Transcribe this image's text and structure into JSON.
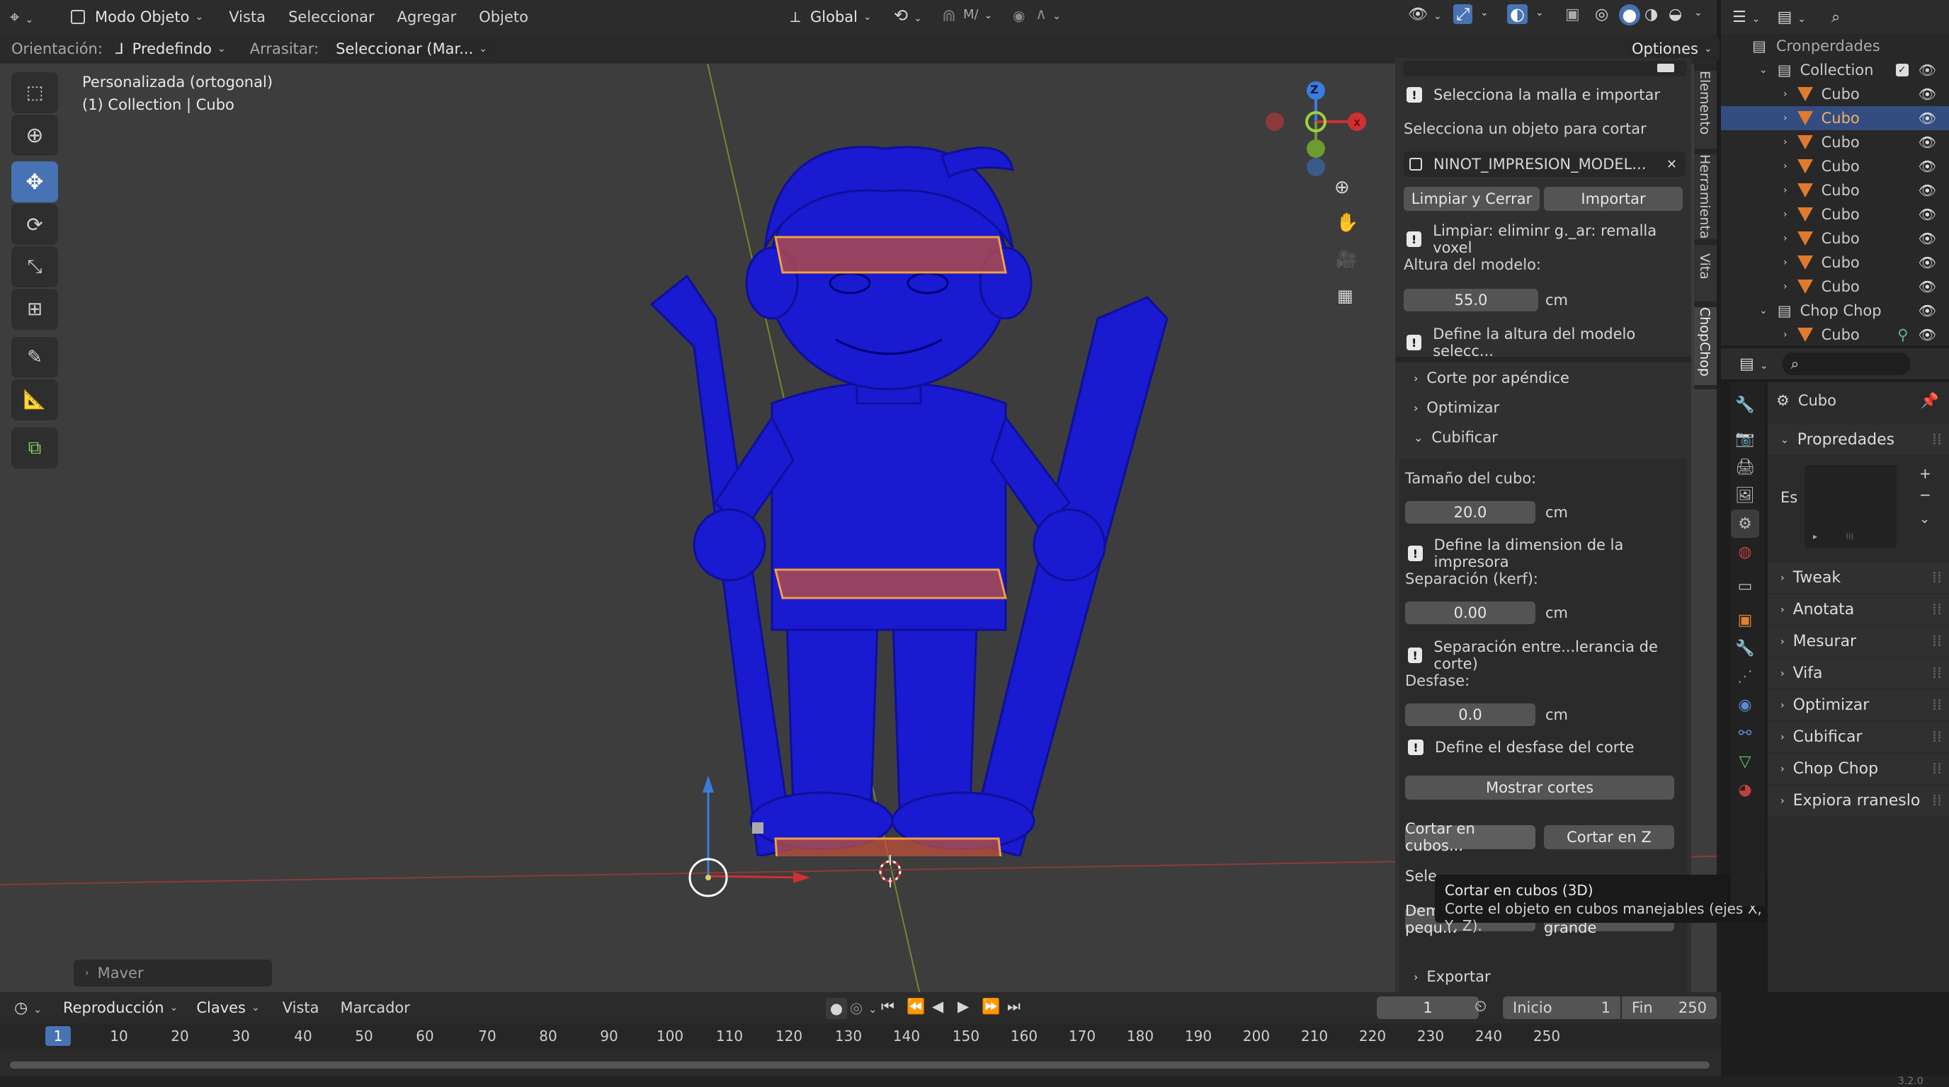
{
  "header": {
    "mode": "Modo Objeto",
    "menus": [
      "Vista",
      "Seleccionar",
      "Agregar",
      "Objeto"
    ],
    "transform_orientation": "Global"
  },
  "subheader": {
    "orientation_label": "Orientación:",
    "orientation_value": "Predefindo",
    "drag_label": "Arrasitar:",
    "drag_value": "Seleccionar (Mar...",
    "options": "Optiones"
  },
  "viewport": {
    "view_name": "Personalizada (ortogonal)",
    "collection_info": "(1) Collection | Cubo",
    "gizmo_z": "Z",
    "last_op": "Maver"
  },
  "npanel": {
    "tabs": [
      "Elemento",
      "Herramienta",
      "Vita",
      "ChopChop"
    ],
    "msg_select": "Selecciona la malla e importar",
    "select_cut_label": "Selecciona un objeto para cortar",
    "object_field": "NINOT_IMPRESION_MODEL...",
    "btn_clear_close": "Limpiar y Cerrar",
    "btn_import": "Importar",
    "msg_clear": "Limpiar: eliminr g._ar: remalla voxel",
    "height_label": "Altura del modelo:",
    "height_value": "55.0",
    "unit_cm": "cm",
    "msg_height": "Define la altura del modelo selecc...",
    "sections": [
      "Corte por apéndice",
      "Optimizar",
      "Cubificar"
    ],
    "cube_size_label": "Tamaño del cubo:",
    "cube_size_value": "20.0",
    "msg_cube": "Define la dimension de la impresora",
    "kerf_label": "Separación (kerf):",
    "kerf_value": "0.00",
    "msg_kerf": "Separación entre...lerancia de corte)",
    "offset_label": "Desfase:",
    "offset_value": "0.0",
    "msg_offset": "Define el desfase del corte",
    "btn_show_cuts": "Mostrar cortes",
    "btn_cut_cubes": "Cortar en cubos...",
    "btn_cut_z": "Cortar en Z",
    "sele_label": "Sele",
    "btn_too_small": "Demasiado pequ...",
    "btn_too_big": "Demasiado grande",
    "export": "Exportar"
  },
  "tooltip": {
    "title": "Cortar en cubos (3D)",
    "desc": "Corte el objeto en cubos manejables (ejes X, Y, Z)."
  },
  "outliner": {
    "root": "Cronperdades",
    "collection": "Collection",
    "items": [
      "Cubo",
      "Cubo",
      "Cubo",
      "Cubo",
      "Cubo",
      "Cubo",
      "Cubo",
      "Cubo",
      "Cubo"
    ],
    "chop_collection": "Chop Chop",
    "chop_item": "Cubo"
  },
  "properties": {
    "object_name": "Cubo",
    "panel_title": "Propredades",
    "es_label": "Es",
    "sections": [
      "Tweak",
      "Anotata",
      "Mesurar",
      "Vifa",
      "Optimizar",
      "Cubificar",
      "Chop Chop",
      "Expiora rraneslo"
    ]
  },
  "timeline": {
    "menus": [
      "Reproducción",
      "Claves",
      "Vista",
      "Marcador"
    ],
    "current_frame": "1",
    "start_label": "Inicio",
    "start_value": "1",
    "end_label": "Fin",
    "end_value": "250",
    "ticks": [
      "1",
      "10",
      "20",
      "30",
      "40",
      "50",
      "60",
      "70",
      "80",
      "90",
      "100",
      "110",
      "120",
      "130",
      "140",
      "150",
      "160",
      "170",
      "180",
      "190",
      "200",
      "210",
      "220",
      "230",
      "240",
      "250"
    ],
    "version": "3.2.0"
  }
}
